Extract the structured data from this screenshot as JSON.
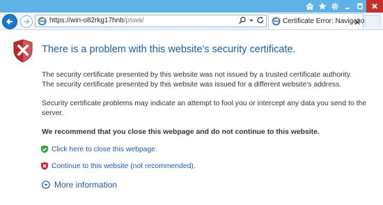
{
  "browser": {
    "address_host": "https://win-o82rkg17hnb",
    "address_path": "/pswa/",
    "tab_title": "Certificate Error: Navigation...",
    "icons": [
      "home-icon",
      "favorites-star-icon",
      "settings-gear-icon",
      "search-icon",
      "dropdown-icon",
      "refresh-icon",
      "back-icon",
      "forward-icon",
      "ie-icon",
      "tab-close-icon"
    ],
    "window_controls": [
      "minimize",
      "maximize",
      "close"
    ]
  },
  "page": {
    "title": "There is a problem with this website's security certificate.",
    "line1": "The security certificate presented by this website was not issued by a trusted certificate authority.",
    "line2": "The security certificate presented by this website was issued for a different website's address.",
    "line3": "Security certificate problems may indicate an attempt to fool you or intercept any data you send to the server.",
    "recommend": "We recommend that you close this webpage and do not continue to this website.",
    "close_link": "Click here to close this webpage.",
    "continue_link": "Continue to this website (not recommended).",
    "more_info": "More information"
  },
  "colors": {
    "titlebar": "#5fb2e5",
    "link": "#1f5aa6",
    "shield_red": "#c4242b",
    "close_button": "#c7302b"
  }
}
